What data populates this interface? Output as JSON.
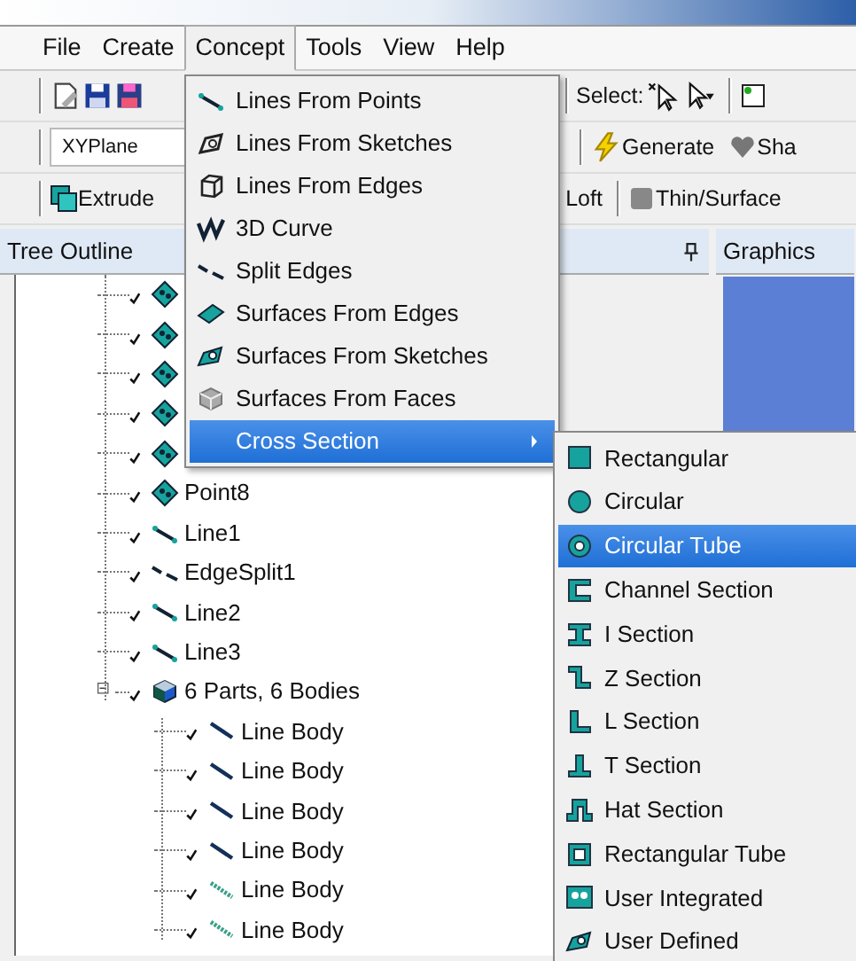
{
  "menubar": [
    {
      "label": "File",
      "selected": false
    },
    {
      "label": "Create",
      "selected": false
    },
    {
      "label": "Concept",
      "selected": true
    },
    {
      "label": "Tools",
      "selected": false
    },
    {
      "label": "View",
      "selected": false
    },
    {
      "label": "Help",
      "selected": false
    }
  ],
  "toolbar_1": {
    "select_label": "Select:"
  },
  "toolbar_2": {
    "plane": "XYPlane",
    "generate": "Generate",
    "share": "Sha"
  },
  "toolbar_3": {
    "extrude": "Extrude",
    "loft": "Loft",
    "thin_surface": "Thin/Surface"
  },
  "tree_outline": {
    "title": "Tree Outline",
    "items": [
      {
        "kind": "point",
        "checked": true
      },
      {
        "kind": "point",
        "checked": true
      },
      {
        "kind": "point",
        "checked": true
      },
      {
        "kind": "point",
        "checked": true
      },
      {
        "kind": "point",
        "checked": true
      },
      {
        "kind": "point",
        "label": "Point8",
        "checked": true
      },
      {
        "kind": "line",
        "label": "Line1",
        "checked": true
      },
      {
        "kind": "split",
        "label": "EdgeSplit1",
        "checked": true
      },
      {
        "kind": "line",
        "label": "Line2",
        "checked": true
      },
      {
        "kind": "line",
        "label": "Line3",
        "checked": true
      },
      {
        "kind": "parts",
        "label": "6 Parts, 6 Bodies",
        "checked": true,
        "expanded": true,
        "children": [
          {
            "kind": "body",
            "label": "Line Body",
            "checked": true
          },
          {
            "kind": "body",
            "label": "Line Body",
            "checked": true
          },
          {
            "kind": "body",
            "label": "Line Body",
            "checked": true
          },
          {
            "kind": "body",
            "label": "Line Body",
            "checked": true
          },
          {
            "kind": "body_light",
            "label": "Line Body",
            "checked": true
          },
          {
            "kind": "body_light",
            "label": "Line Body",
            "checked": true
          }
        ]
      }
    ]
  },
  "graphics": {
    "title": "Graphics"
  },
  "concept_menu": {
    "items": [
      {
        "kind": "command",
        "label": "Lines From Points",
        "selected": false
      },
      {
        "kind": "command",
        "label": "Lines From Sketches",
        "selected": false
      },
      {
        "kind": "command",
        "label": "Lines From Edges",
        "selected": false
      },
      {
        "kind": "command",
        "label": "3D Curve",
        "selected": false
      },
      {
        "kind": "command",
        "label": "Split Edges",
        "selected": false
      },
      {
        "kind": "command",
        "label": "Surfaces From Edges",
        "selected": false
      },
      {
        "kind": "command",
        "label": "Surfaces From Sketches",
        "selected": false
      },
      {
        "kind": "command",
        "label": "Surfaces From Faces",
        "selected": false
      },
      {
        "kind": "submenu",
        "label": "Cross Section",
        "selected": true
      }
    ]
  },
  "cross_section_menu": {
    "items": [
      {
        "label": "Rectangular",
        "selected": false
      },
      {
        "label": "Circular",
        "selected": false
      },
      {
        "label": "Circular Tube",
        "selected": true
      },
      {
        "label": "Channel Section",
        "selected": false
      },
      {
        "label": "I Section",
        "selected": false
      },
      {
        "label": "Z Section",
        "selected": false
      },
      {
        "label": "L Section",
        "selected": false
      },
      {
        "label": "T Section",
        "selected": false
      },
      {
        "label": "Hat Section",
        "selected": false
      },
      {
        "label": "Rectangular Tube",
        "selected": false
      },
      {
        "label": "User Integrated",
        "selected": false
      },
      {
        "label": "User Defined",
        "selected": false
      }
    ]
  }
}
